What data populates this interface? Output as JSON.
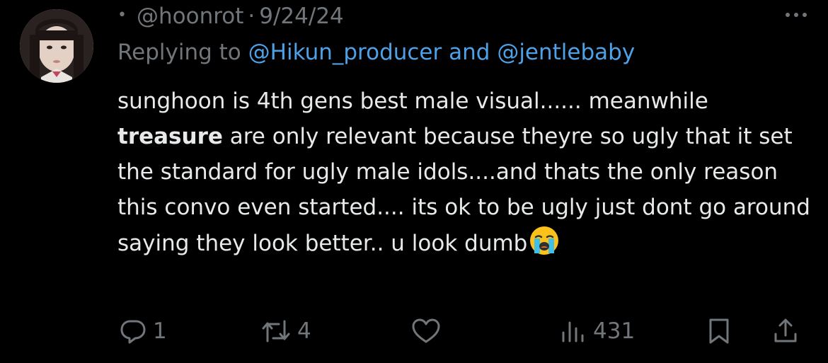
{
  "tweet": {
    "verified_dot": "•",
    "handle": "@hoonrot",
    "separator": "·",
    "date": "9/24/24",
    "reply_prefix": "Replying to",
    "reply_user_1": "@Hikun_producer",
    "reply_and": "and",
    "reply_user_2": "@jentlebaby",
    "text_part_1": "sunghoon is 4th gens best male visual...... meanwhile ",
    "text_bold": "treasure",
    "text_part_2": " are only relevant because theyre so ugly that it set the standard for ugly male idols....and thats the only reason this convo even started.... its ok to be ugly just dont go around saying they look better.. u look dumb",
    "emoji": "loudly-crying-face-emoji"
  },
  "actions": {
    "reply_count": "1",
    "retweet_count": "4",
    "views_count": "431"
  },
  "colors": {
    "background": "#000000",
    "text": "#e7e9ea",
    "muted": "#71767b",
    "link": "#4ea1e6"
  }
}
